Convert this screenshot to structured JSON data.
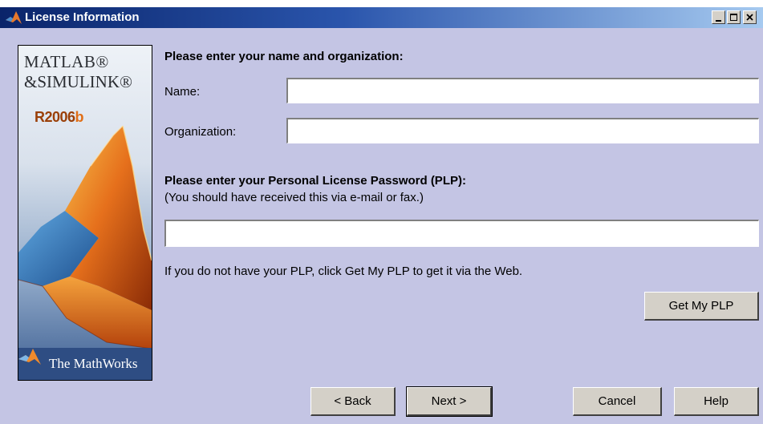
{
  "window": {
    "title": "License Information"
  },
  "banner": {
    "brand_line_1": "MATLAB®",
    "brand_line_2": "&SIMULINK®",
    "release_prefix": "R2006",
    "release_suffix": "b",
    "maker": "The MathWorks"
  },
  "form": {
    "name_heading": "Please enter your name and organization:",
    "name_label": "Name:",
    "name_value": "",
    "organization_label": "Organization:",
    "organization_value": "",
    "plp_heading": "Please enter your Personal License Password (PLP):",
    "plp_subheading": "(You should have received this via e-mail or fax.)",
    "plp_value": "",
    "plp_help_text": "If you do not have your PLP, click Get My PLP to get it via the Web.",
    "get_plp_label": "Get My PLP"
  },
  "footer": {
    "back_label": "< Back",
    "next_label": "Next >",
    "cancel_label": "Cancel",
    "help_label": "Help"
  },
  "colors": {
    "dialog_background": "#c4c5e4",
    "title_bar": "#0a246a",
    "button_face": "#d4d0c8"
  }
}
